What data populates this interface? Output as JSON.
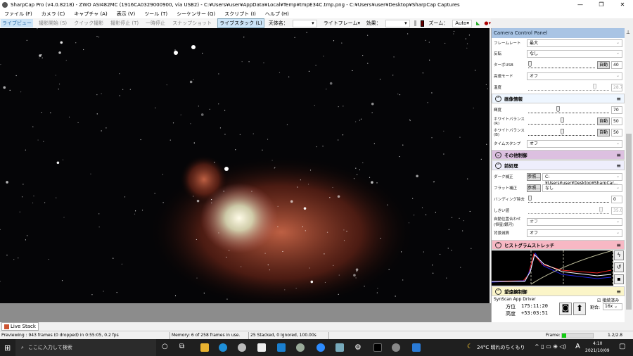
{
  "window": {
    "title": "SharpCap Pro (v4.0.8218) - ZWO ASI482MC (1916CA0329000900, via USB2) - C:¥Users¥user¥AppData¥Local¥Temp¥tmpE34C.tmp.png - C:¥Users¥user¥Desktop¥SharpCap Captures"
  },
  "menu": [
    "ファイル (F)",
    "カメラ (C)",
    "キャプチャ (A)",
    "表示 (V)",
    "ツール (T)",
    "シーケンサー (Q)",
    "スクリプト (I)",
    "ヘルプ (H)"
  ],
  "toolbar": {
    "live_view": "ライブビュー",
    "start_capture": "撮影開始 (S)",
    "quick_capture": "クイック撮影",
    "stop_capture": "撮影停止 (T)",
    "pause": "一時停止",
    "snapshot": "スナップショット",
    "live_stack": "ライブスタック (L)",
    "target_label": "天体名：",
    "target_value": "",
    "frame_type": "ライトフレーム",
    "effect_label": "効果：",
    "effect_value": "",
    "zoom_label": "ズーム：",
    "zoom_value": "Auto"
  },
  "panel": {
    "title": "Camera Control Panel",
    "camera": [
      {
        "label": "フレームレート",
        "value": "最大"
      },
      {
        "label": "反転",
        "value": "なし"
      },
      {
        "label": "ターボUSB",
        "auto": "自動",
        "value": "40",
        "pos": 0
      },
      {
        "label": "高速モード",
        "value": "オフ"
      },
      {
        "label": "温度",
        "value": "28.7",
        "pos": 0.8
      }
    ],
    "image_info": {
      "title": "画像情報",
      "brightness": {
        "label": "輝度",
        "value": "70",
        "pos": 0.35
      },
      "wb_r": {
        "label": "ホワイトバランス(R)",
        "auto": "自動",
        "value": "50",
        "pos": 0.5
      },
      "wb_b": {
        "label": "ホワイトバランス(B)",
        "auto": "自動",
        "value": "50",
        "pos": 0.5
      },
      "timestamp": {
        "label": "タイムスタンプ",
        "value": "オフ"
      }
    },
    "other": {
      "title": "その他制御"
    },
    "preprocess": {
      "title": "前処理",
      "dark": {
        "label": "ダーク補正",
        "browse": "参照...",
        "value": "C:¥Users¥user¥Desktop¥SharpCar..."
      },
      "flat": {
        "label": "フラット補正",
        "browse": "参照...",
        "value": "なし"
      },
      "banding": {
        "label": "バンディング除去",
        "value": "0",
        "pos": 0
      },
      "threshold": {
        "label": "しきい値",
        "value": "35.0",
        "pos": 0.88
      },
      "align": {
        "label": "自動位置合わせ(恒星/銀河)",
        "value": "オフ"
      },
      "bg": {
        "label": "背景減算",
        "value": "オフ"
      }
    },
    "histogram": {
      "title": "ヒストグラムストレッチ"
    },
    "telescope": {
      "title": "望遠鏡制御",
      "driver": "SynScan App Driver",
      "connected": "接続済み",
      "az_label": "方位",
      "az": "175:11:20",
      "alt_label": "高度",
      "alt": "+53:03:51",
      "rate_label": "割合:",
      "rate": "16x"
    }
  },
  "tab": "Live Stack",
  "status": {
    "preview": "Previewing : 943 frames (0 dropped) in 0:55:05, 0.2 fps",
    "memory": "Memory: 6 of 258 frames in use.",
    "stacked": "25 Stacked, 0 Ignored, 100.00s",
    "frame_label": "Frame:",
    "frame_count": "1.2/2.8",
    "frame_fill": 0.13
  },
  "taskbar": {
    "search": "ここに入力して検索",
    "weather": "24°C 晴れのちくもり",
    "ime": "A",
    "time": "4:10",
    "date": "2021/10/09"
  }
}
